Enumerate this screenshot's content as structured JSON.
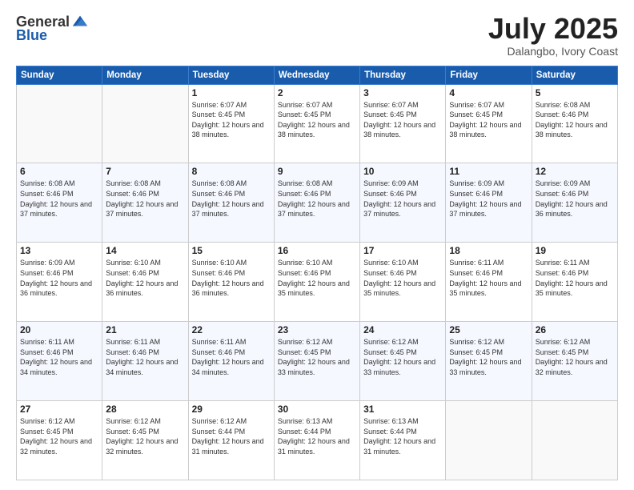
{
  "header": {
    "logo_general": "General",
    "logo_blue": "Blue",
    "month_year": "July 2025",
    "location": "Dalangbo, Ivory Coast"
  },
  "days_of_week": [
    "Sunday",
    "Monday",
    "Tuesday",
    "Wednesday",
    "Thursday",
    "Friday",
    "Saturday"
  ],
  "weeks": [
    [
      {
        "day": "",
        "sunrise": "",
        "sunset": "",
        "daylight": ""
      },
      {
        "day": "",
        "sunrise": "",
        "sunset": "",
        "daylight": ""
      },
      {
        "day": "1",
        "sunrise": "Sunrise: 6:07 AM",
        "sunset": "Sunset: 6:45 PM",
        "daylight": "Daylight: 12 hours and 38 minutes."
      },
      {
        "day": "2",
        "sunrise": "Sunrise: 6:07 AM",
        "sunset": "Sunset: 6:45 PM",
        "daylight": "Daylight: 12 hours and 38 minutes."
      },
      {
        "day": "3",
        "sunrise": "Sunrise: 6:07 AM",
        "sunset": "Sunset: 6:45 PM",
        "daylight": "Daylight: 12 hours and 38 minutes."
      },
      {
        "day": "4",
        "sunrise": "Sunrise: 6:07 AM",
        "sunset": "Sunset: 6:45 PM",
        "daylight": "Daylight: 12 hours and 38 minutes."
      },
      {
        "day": "5",
        "sunrise": "Sunrise: 6:08 AM",
        "sunset": "Sunset: 6:46 PM",
        "daylight": "Daylight: 12 hours and 38 minutes."
      }
    ],
    [
      {
        "day": "6",
        "sunrise": "Sunrise: 6:08 AM",
        "sunset": "Sunset: 6:46 PM",
        "daylight": "Daylight: 12 hours and 37 minutes."
      },
      {
        "day": "7",
        "sunrise": "Sunrise: 6:08 AM",
        "sunset": "Sunset: 6:46 PM",
        "daylight": "Daylight: 12 hours and 37 minutes."
      },
      {
        "day": "8",
        "sunrise": "Sunrise: 6:08 AM",
        "sunset": "Sunset: 6:46 PM",
        "daylight": "Daylight: 12 hours and 37 minutes."
      },
      {
        "day": "9",
        "sunrise": "Sunrise: 6:08 AM",
        "sunset": "Sunset: 6:46 PM",
        "daylight": "Daylight: 12 hours and 37 minutes."
      },
      {
        "day": "10",
        "sunrise": "Sunrise: 6:09 AM",
        "sunset": "Sunset: 6:46 PM",
        "daylight": "Daylight: 12 hours and 37 minutes."
      },
      {
        "day": "11",
        "sunrise": "Sunrise: 6:09 AM",
        "sunset": "Sunset: 6:46 PM",
        "daylight": "Daylight: 12 hours and 37 minutes."
      },
      {
        "day": "12",
        "sunrise": "Sunrise: 6:09 AM",
        "sunset": "Sunset: 6:46 PM",
        "daylight": "Daylight: 12 hours and 36 minutes."
      }
    ],
    [
      {
        "day": "13",
        "sunrise": "Sunrise: 6:09 AM",
        "sunset": "Sunset: 6:46 PM",
        "daylight": "Daylight: 12 hours and 36 minutes."
      },
      {
        "day": "14",
        "sunrise": "Sunrise: 6:10 AM",
        "sunset": "Sunset: 6:46 PM",
        "daylight": "Daylight: 12 hours and 36 minutes."
      },
      {
        "day": "15",
        "sunrise": "Sunrise: 6:10 AM",
        "sunset": "Sunset: 6:46 PM",
        "daylight": "Daylight: 12 hours and 36 minutes."
      },
      {
        "day": "16",
        "sunrise": "Sunrise: 6:10 AM",
        "sunset": "Sunset: 6:46 PM",
        "daylight": "Daylight: 12 hours and 35 minutes."
      },
      {
        "day": "17",
        "sunrise": "Sunrise: 6:10 AM",
        "sunset": "Sunset: 6:46 PM",
        "daylight": "Daylight: 12 hours and 35 minutes."
      },
      {
        "day": "18",
        "sunrise": "Sunrise: 6:11 AM",
        "sunset": "Sunset: 6:46 PM",
        "daylight": "Daylight: 12 hours and 35 minutes."
      },
      {
        "day": "19",
        "sunrise": "Sunrise: 6:11 AM",
        "sunset": "Sunset: 6:46 PM",
        "daylight": "Daylight: 12 hours and 35 minutes."
      }
    ],
    [
      {
        "day": "20",
        "sunrise": "Sunrise: 6:11 AM",
        "sunset": "Sunset: 6:46 PM",
        "daylight": "Daylight: 12 hours and 34 minutes."
      },
      {
        "day": "21",
        "sunrise": "Sunrise: 6:11 AM",
        "sunset": "Sunset: 6:46 PM",
        "daylight": "Daylight: 12 hours and 34 minutes."
      },
      {
        "day": "22",
        "sunrise": "Sunrise: 6:11 AM",
        "sunset": "Sunset: 6:46 PM",
        "daylight": "Daylight: 12 hours and 34 minutes."
      },
      {
        "day": "23",
        "sunrise": "Sunrise: 6:12 AM",
        "sunset": "Sunset: 6:45 PM",
        "daylight": "Daylight: 12 hours and 33 minutes."
      },
      {
        "day": "24",
        "sunrise": "Sunrise: 6:12 AM",
        "sunset": "Sunset: 6:45 PM",
        "daylight": "Daylight: 12 hours and 33 minutes."
      },
      {
        "day": "25",
        "sunrise": "Sunrise: 6:12 AM",
        "sunset": "Sunset: 6:45 PM",
        "daylight": "Daylight: 12 hours and 33 minutes."
      },
      {
        "day": "26",
        "sunrise": "Sunrise: 6:12 AM",
        "sunset": "Sunset: 6:45 PM",
        "daylight": "Daylight: 12 hours and 32 minutes."
      }
    ],
    [
      {
        "day": "27",
        "sunrise": "Sunrise: 6:12 AM",
        "sunset": "Sunset: 6:45 PM",
        "daylight": "Daylight: 12 hours and 32 minutes."
      },
      {
        "day": "28",
        "sunrise": "Sunrise: 6:12 AM",
        "sunset": "Sunset: 6:45 PM",
        "daylight": "Daylight: 12 hours and 32 minutes."
      },
      {
        "day": "29",
        "sunrise": "Sunrise: 6:12 AM",
        "sunset": "Sunset: 6:44 PM",
        "daylight": "Daylight: 12 hours and 31 minutes."
      },
      {
        "day": "30",
        "sunrise": "Sunrise: 6:13 AM",
        "sunset": "Sunset: 6:44 PM",
        "daylight": "Daylight: 12 hours and 31 minutes."
      },
      {
        "day": "31",
        "sunrise": "Sunrise: 6:13 AM",
        "sunset": "Sunset: 6:44 PM",
        "daylight": "Daylight: 12 hours and 31 minutes."
      },
      {
        "day": "",
        "sunrise": "",
        "sunset": "",
        "daylight": ""
      },
      {
        "day": "",
        "sunrise": "",
        "sunset": "",
        "daylight": ""
      }
    ]
  ]
}
